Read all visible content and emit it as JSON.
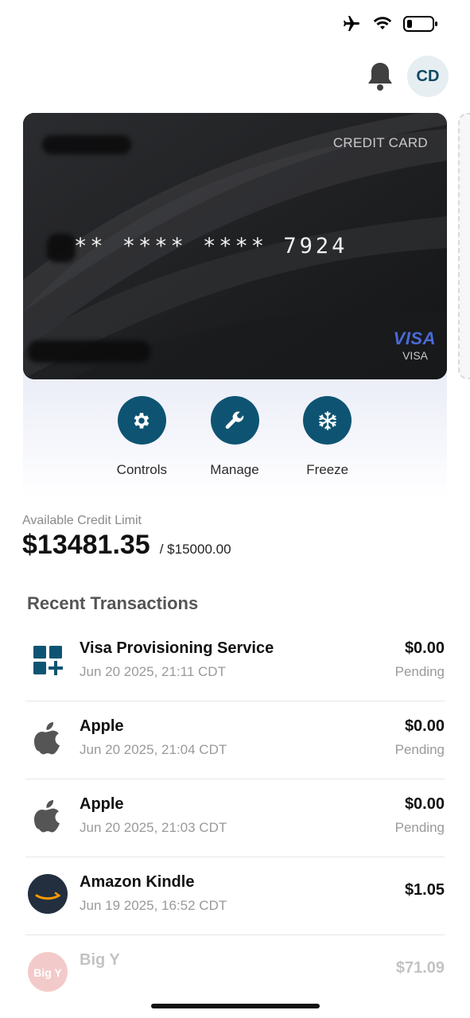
{
  "header": {
    "avatar_initials": "CD"
  },
  "card": {
    "type_label": "CREDIT CARD",
    "masked_number": "** **** **** 7924",
    "network_logo": "VISA",
    "network_label": "VISA"
  },
  "actions": [
    {
      "label": "Controls",
      "icon": "gear-icon"
    },
    {
      "label": "Manage",
      "icon": "wrench-icon"
    },
    {
      "label": "Freeze",
      "icon": "snowflake-icon"
    }
  ],
  "credit": {
    "caption": "Available Credit Limit",
    "available": "$13481.35",
    "limit": "/ $15000.00"
  },
  "transactions": {
    "title": "Recent Transactions",
    "items": [
      {
        "name": "Visa Provisioning Service",
        "date": "Jun 20 2025, 21:11 CDT",
        "amount": "$0.00",
        "status": "Pending",
        "icon": "grid-plus-icon"
      },
      {
        "name": "Apple",
        "date": "Jun 20 2025, 21:04 CDT",
        "amount": "$0.00",
        "status": "Pending",
        "icon": "apple-icon"
      },
      {
        "name": "Apple",
        "date": "Jun 20 2025, 21:03 CDT",
        "amount": "$0.00",
        "status": "Pending",
        "icon": "apple-icon"
      },
      {
        "name": "Amazon Kindle",
        "date": "Jun 19 2025, 16:52 CDT",
        "amount": "$1.05",
        "status": "",
        "icon": "amazon-icon"
      },
      {
        "name": "Big Y",
        "date": "",
        "amount": "$71.09",
        "status": "",
        "icon": "big-y-icon"
      }
    ]
  },
  "colors": {
    "accent": "#0e5472",
    "card": "#1d1e20",
    "panel": "#eceef8"
  }
}
